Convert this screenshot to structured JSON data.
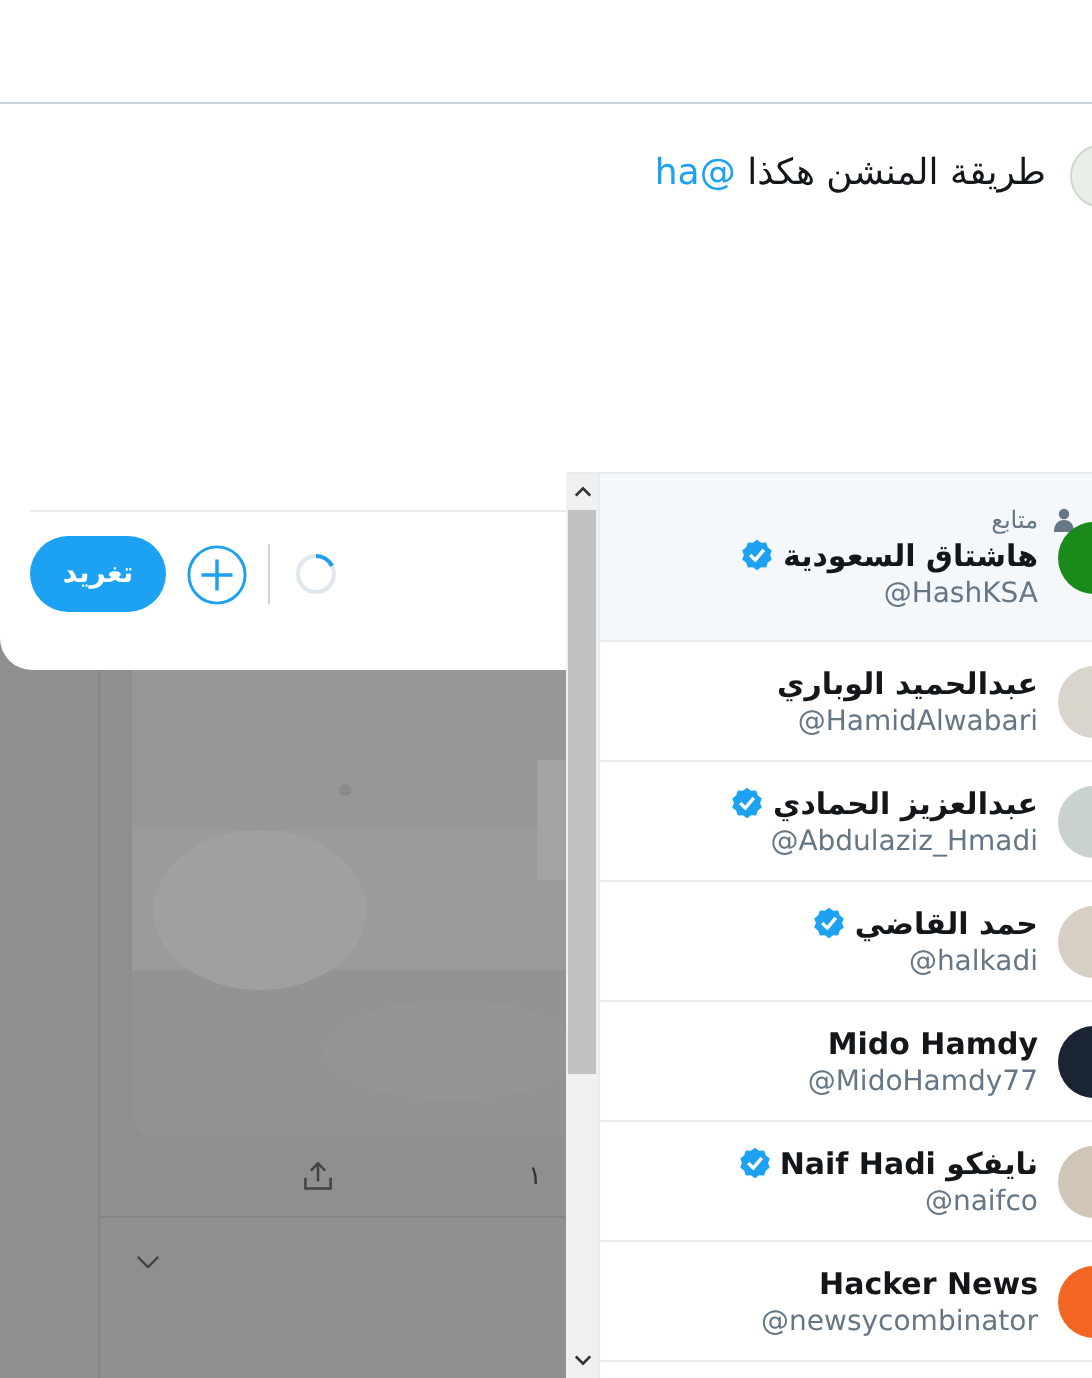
{
  "compose": {
    "text": "طريقة المنشن هكذا",
    "mention": "@ha",
    "tweet_button": "تغريد"
  },
  "feed": {
    "share_count": "١"
  },
  "suggestions": {
    "items": [
      {
        "name": "هاشتاق السعودية",
        "handle": "@HashKSA",
        "verified": true,
        "selected": true,
        "follows_you": "متابع",
        "color": "#1a8a1a"
      },
      {
        "name": "عبدالحميد الوباري",
        "handle": "@HamidAlwabari",
        "verified": false,
        "selected": false,
        "color": "#d9d4cc"
      },
      {
        "name": "عبدالعزيز الحمادي",
        "handle": "@Abdulaziz_Hmadi",
        "verified": true,
        "selected": false,
        "color": "#c9d2cc"
      },
      {
        "name": "حمد القاضي",
        "handle": "@halkadi",
        "verified": true,
        "selected": false,
        "color": "#d8cfc4"
      },
      {
        "name": "Mido Hamdy",
        "handle": "@MidoHamdy77",
        "verified": false,
        "selected": false,
        "color": "#1b2433"
      },
      {
        "name": "نايفكو Naif Hadi",
        "handle": "@naifco",
        "verified": true,
        "selected": false,
        "color": "#cfc6b8"
      },
      {
        "name": "Hacker News",
        "handle": "@newsycombinator",
        "verified": false,
        "selected": false,
        "color": "#f26522"
      }
    ]
  }
}
